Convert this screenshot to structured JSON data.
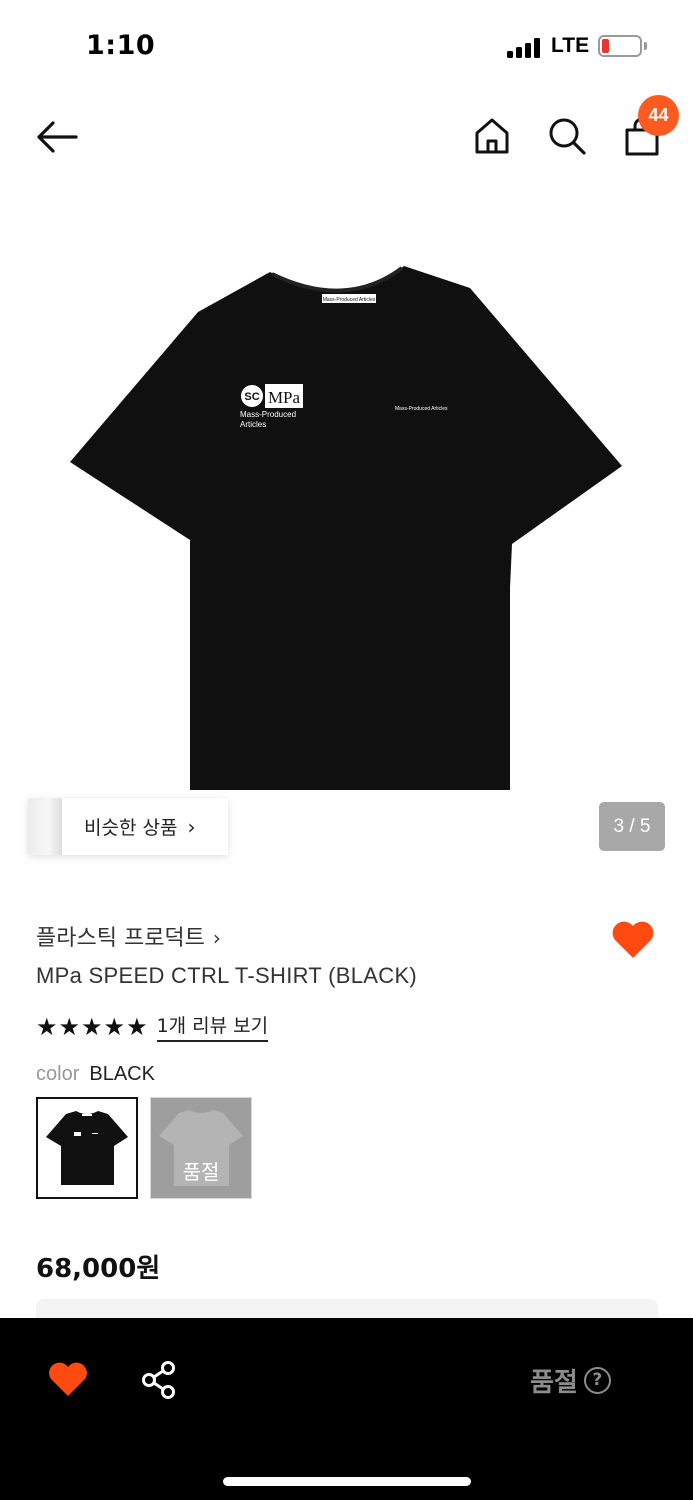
{
  "status_bar": {
    "time": "1:10",
    "network": "LTE",
    "signal_bars": 4,
    "battery_level": 0.15,
    "battery_color": "#e8362f"
  },
  "nav": {
    "back_icon": "arrow-left-icon",
    "home_icon": "home-icon",
    "search_icon": "search-icon",
    "cart_icon": "shopping-bag-icon",
    "cart_count": "44",
    "badge_color": "#ff5a1f"
  },
  "product_image": {
    "shirt_print_logo": "SC MPa",
    "shirt_print_brand": "Mass-Produced Articles",
    "shirt_neck_label": "Mass-Produced Articles"
  },
  "gallery": {
    "similar_label": "비슷한 상품",
    "similar_arrow": "›",
    "counter": "3 / 5"
  },
  "product": {
    "brand": "플라스틱 프로덕트",
    "brand_arrow": "›",
    "title": "MPa SPEED CTRL T-SHIRT (BLACK)",
    "rating_stars": 5,
    "review_link": "1개 리뷰 보기",
    "color_label": "color",
    "color_value": "BLACK",
    "options": [
      {
        "name": "BLACK",
        "soldout": false
      },
      {
        "name": "GRAY",
        "soldout": true,
        "soldout_text": "품절"
      }
    ],
    "price": "68,000원",
    "wish_color": "#ff4a12"
  },
  "bottom_bar": {
    "heart_icon": "heart-icon",
    "share_icon": "share-icon",
    "status_label": "품절",
    "help_icon": "?"
  }
}
